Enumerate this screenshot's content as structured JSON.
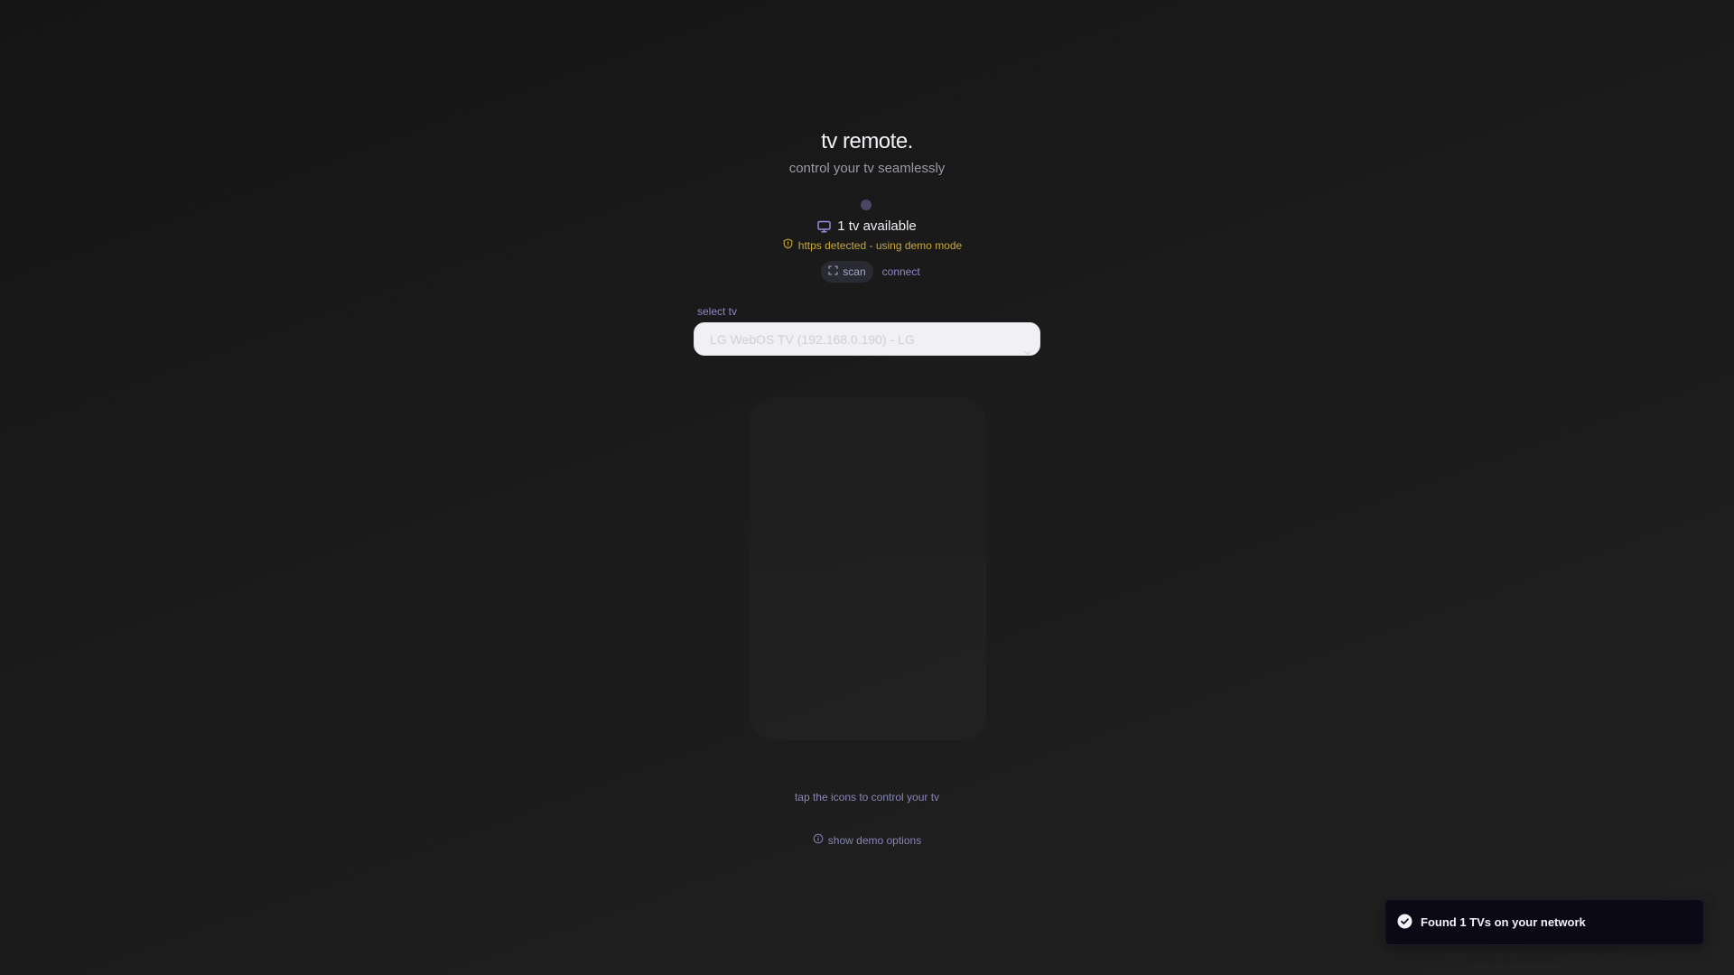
{
  "header": {
    "title": "tv remote.",
    "subtitle": "control your tv seamlessly"
  },
  "status": {
    "tv_count_label": "1 tv available",
    "https_warning": "https detected - using demo mode"
  },
  "actions": {
    "scan_label": "scan",
    "connect_label": "connect"
  },
  "tv_select": {
    "label": "select tv",
    "selected": "LG WebOS TV (192.168.0.190) - LG"
  },
  "footer": {
    "tap_hint": "tap the icons to control your tv",
    "demo_toggle_label": "show demo options"
  },
  "toast": {
    "message": "Found 1 TVs on your network"
  },
  "icons": {
    "tv": "tv-icon",
    "warning": "shield-alert-icon",
    "scan": "scan-icon",
    "chevron": "chevron-down-icon",
    "info": "info-icon",
    "success": "check-circle-icon"
  },
  "colors": {
    "background": "#1a1a1a",
    "accent": "#8f88c8",
    "warning": "#c6a93b",
    "status_dot": "#4a4766",
    "toast_bg": "#0b0916"
  }
}
